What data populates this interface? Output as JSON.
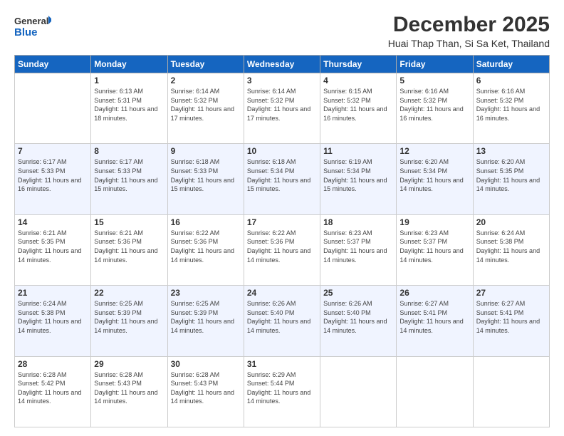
{
  "logo": {
    "line1": "General",
    "line2": "Blue"
  },
  "header": {
    "month": "December 2025",
    "location": "Huai Thap Than, Si Sa Ket, Thailand"
  },
  "days_of_week": [
    "Sunday",
    "Monday",
    "Tuesday",
    "Wednesday",
    "Thursday",
    "Friday",
    "Saturday"
  ],
  "weeks": [
    [
      {
        "day": "",
        "info": ""
      },
      {
        "day": "1",
        "info": "Sunrise: 6:13 AM\nSunset: 5:31 PM\nDaylight: 11 hours\nand 18 minutes."
      },
      {
        "day": "2",
        "info": "Sunrise: 6:14 AM\nSunset: 5:32 PM\nDaylight: 11 hours\nand 17 minutes."
      },
      {
        "day": "3",
        "info": "Sunrise: 6:14 AM\nSunset: 5:32 PM\nDaylight: 11 hours\nand 17 minutes."
      },
      {
        "day": "4",
        "info": "Sunrise: 6:15 AM\nSunset: 5:32 PM\nDaylight: 11 hours\nand 16 minutes."
      },
      {
        "day": "5",
        "info": "Sunrise: 6:16 AM\nSunset: 5:32 PM\nDaylight: 11 hours\nand 16 minutes."
      },
      {
        "day": "6",
        "info": "Sunrise: 6:16 AM\nSunset: 5:32 PM\nDaylight: 11 hours\nand 16 minutes."
      }
    ],
    [
      {
        "day": "7",
        "info": "Sunrise: 6:17 AM\nSunset: 5:33 PM\nDaylight: 11 hours\nand 16 minutes."
      },
      {
        "day": "8",
        "info": "Sunrise: 6:17 AM\nSunset: 5:33 PM\nDaylight: 11 hours\nand 15 minutes."
      },
      {
        "day": "9",
        "info": "Sunrise: 6:18 AM\nSunset: 5:33 PM\nDaylight: 11 hours\nand 15 minutes."
      },
      {
        "day": "10",
        "info": "Sunrise: 6:18 AM\nSunset: 5:34 PM\nDaylight: 11 hours\nand 15 minutes."
      },
      {
        "day": "11",
        "info": "Sunrise: 6:19 AM\nSunset: 5:34 PM\nDaylight: 11 hours\nand 15 minutes."
      },
      {
        "day": "12",
        "info": "Sunrise: 6:20 AM\nSunset: 5:34 PM\nDaylight: 11 hours\nand 14 minutes."
      },
      {
        "day": "13",
        "info": "Sunrise: 6:20 AM\nSunset: 5:35 PM\nDaylight: 11 hours\nand 14 minutes."
      }
    ],
    [
      {
        "day": "14",
        "info": "Sunrise: 6:21 AM\nSunset: 5:35 PM\nDaylight: 11 hours\nand 14 minutes."
      },
      {
        "day": "15",
        "info": "Sunrise: 6:21 AM\nSunset: 5:36 PM\nDaylight: 11 hours\nand 14 minutes."
      },
      {
        "day": "16",
        "info": "Sunrise: 6:22 AM\nSunset: 5:36 PM\nDaylight: 11 hours\nand 14 minutes."
      },
      {
        "day": "17",
        "info": "Sunrise: 6:22 AM\nSunset: 5:36 PM\nDaylight: 11 hours\nand 14 minutes."
      },
      {
        "day": "18",
        "info": "Sunrise: 6:23 AM\nSunset: 5:37 PM\nDaylight: 11 hours\nand 14 minutes."
      },
      {
        "day": "19",
        "info": "Sunrise: 6:23 AM\nSunset: 5:37 PM\nDaylight: 11 hours\nand 14 minutes."
      },
      {
        "day": "20",
        "info": "Sunrise: 6:24 AM\nSunset: 5:38 PM\nDaylight: 11 hours\nand 14 minutes."
      }
    ],
    [
      {
        "day": "21",
        "info": "Sunrise: 6:24 AM\nSunset: 5:38 PM\nDaylight: 11 hours\nand 14 minutes."
      },
      {
        "day": "22",
        "info": "Sunrise: 6:25 AM\nSunset: 5:39 PM\nDaylight: 11 hours\nand 14 minutes."
      },
      {
        "day": "23",
        "info": "Sunrise: 6:25 AM\nSunset: 5:39 PM\nDaylight: 11 hours\nand 14 minutes."
      },
      {
        "day": "24",
        "info": "Sunrise: 6:26 AM\nSunset: 5:40 PM\nDaylight: 11 hours\nand 14 minutes."
      },
      {
        "day": "25",
        "info": "Sunrise: 6:26 AM\nSunset: 5:40 PM\nDaylight: 11 hours\nand 14 minutes."
      },
      {
        "day": "26",
        "info": "Sunrise: 6:27 AM\nSunset: 5:41 PM\nDaylight: 11 hours\nand 14 minutes."
      },
      {
        "day": "27",
        "info": "Sunrise: 6:27 AM\nSunset: 5:41 PM\nDaylight: 11 hours\nand 14 minutes."
      }
    ],
    [
      {
        "day": "28",
        "info": "Sunrise: 6:28 AM\nSunset: 5:42 PM\nDaylight: 11 hours\nand 14 minutes."
      },
      {
        "day": "29",
        "info": "Sunrise: 6:28 AM\nSunset: 5:43 PM\nDaylight: 11 hours\nand 14 minutes."
      },
      {
        "day": "30",
        "info": "Sunrise: 6:28 AM\nSunset: 5:43 PM\nDaylight: 11 hours\nand 14 minutes."
      },
      {
        "day": "31",
        "info": "Sunrise: 6:29 AM\nSunset: 5:44 PM\nDaylight: 11 hours\nand 14 minutes."
      },
      {
        "day": "",
        "info": ""
      },
      {
        "day": "",
        "info": ""
      },
      {
        "day": "",
        "info": ""
      }
    ]
  ]
}
